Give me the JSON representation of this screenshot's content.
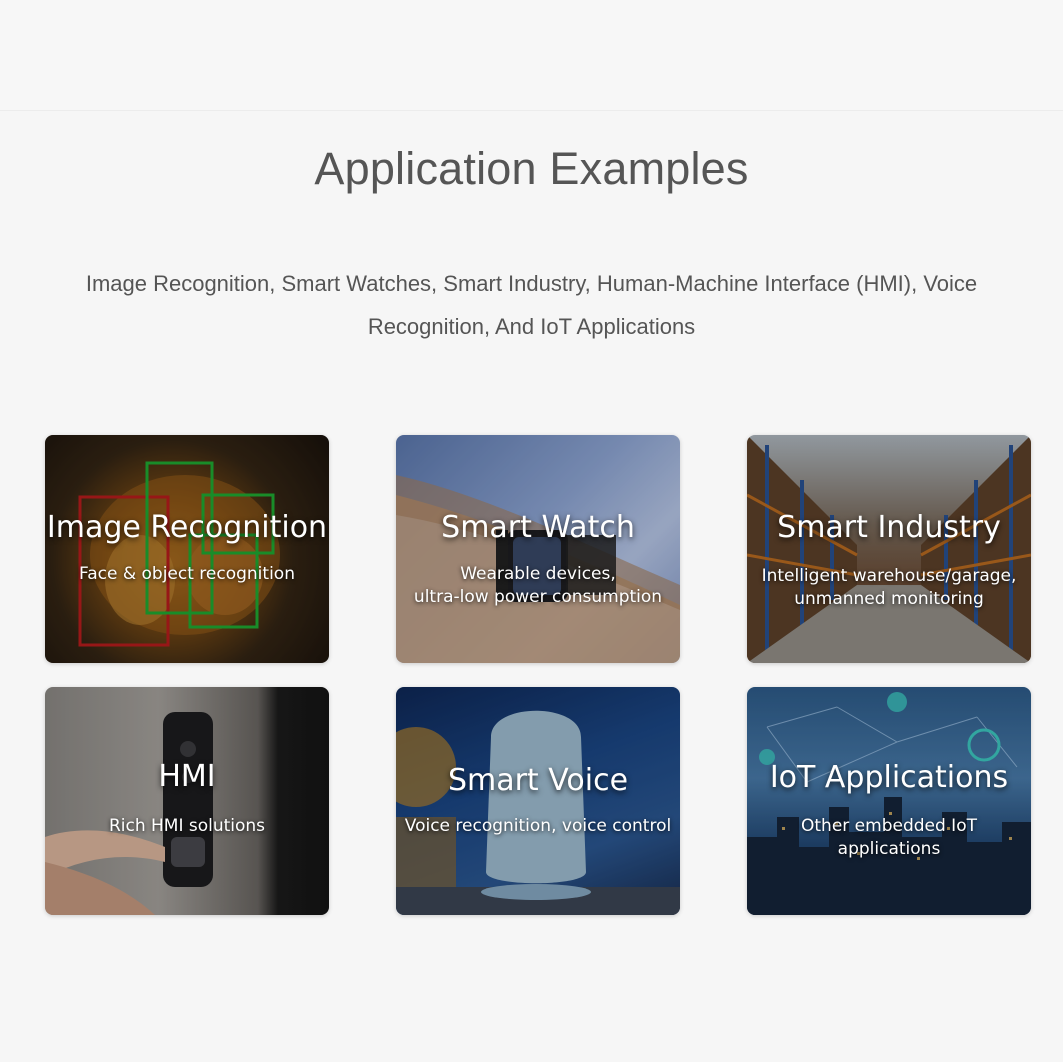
{
  "section": {
    "title": "Application Examples",
    "subtitle": "Image Recognition, Smart Watches, Smart Industry, Human-Machine Interface (HMI), Voice Recognition, And IoT Applications"
  },
  "cards": [
    {
      "title": "Image Recognition",
      "desc": "Face & object recognition"
    },
    {
      "title": "Smart Watch",
      "desc": "Wearable devices,\nultra-low power consumption"
    },
    {
      "title": "Smart Industry",
      "desc": "Intelligent warehouse/garage,\nunmanned monitoring"
    },
    {
      "title": "HMI",
      "desc": "Rich HMI solutions"
    },
    {
      "title": "Smart Voice",
      "desc": "Voice recognition, voice control"
    },
    {
      "title": "IoT Applications",
      "desc": "Other embedded IoT\napplications"
    }
  ]
}
